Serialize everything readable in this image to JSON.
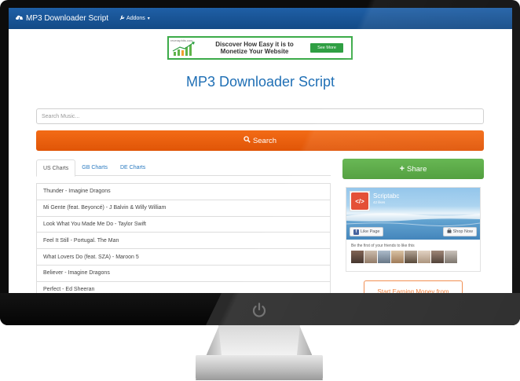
{
  "navbar": {
    "brand": "MP3 Downloader Script",
    "addons_label": "Addons"
  },
  "ad": {
    "logo_text": "reveraphits.com",
    "headline": "Discover How Easy it is to Monetize Your Website",
    "button": "See More",
    "accent_color": "#3cab49"
  },
  "page": {
    "title": "MP3 Downloader Script"
  },
  "search": {
    "placeholder": "Search Music...",
    "button_label": "Search"
  },
  "tabs": [
    {
      "label": "US Charts",
      "active": true
    },
    {
      "label": "GB Charts",
      "active": false
    },
    {
      "label": "DE Charts",
      "active": false
    }
  ],
  "chart_items": [
    "Thunder - Imagine Dragons",
    "Mi Gente (feat. Beyoncé) - J Balvin & Willy William",
    "Look What You Made Me Do - Taylor Swift",
    "Feel It Still - Portugal. The Man",
    "What Lovers Do (feat. SZA) - Maroon 5",
    "Believer - Imagine Dragons",
    "Perfect - Ed Sheeran"
  ],
  "share": {
    "button_label": "Share"
  },
  "facebook": {
    "page_name": "Scriptabc",
    "likes": "42 likes",
    "like_button": "Like Page",
    "shop_button": "Shop Now",
    "friends_text": "Be the first of your friends to like this"
  },
  "promo": {
    "label": "Start Earning Money from"
  },
  "colors": {
    "navbar": "#134a86",
    "title": "#1f6fb5",
    "search_button": "#e05507",
    "share_button": "#4a9b36",
    "link": "#2a7ac0"
  }
}
